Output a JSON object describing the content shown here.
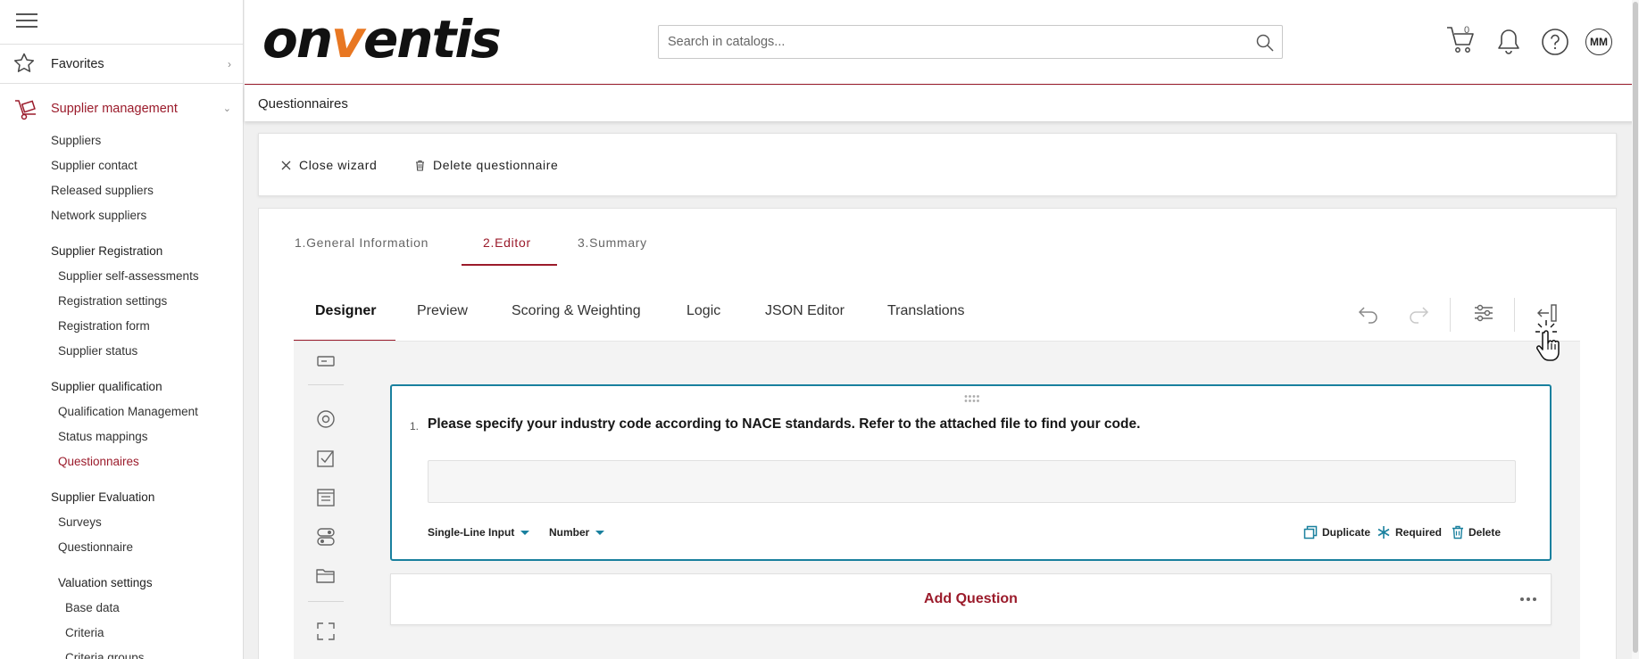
{
  "sidebar": {
    "favorites_label": "Favorites",
    "supplier_management_label": "Supplier management",
    "items": [
      "Suppliers",
      "Supplier contact",
      "Released suppliers",
      "Network suppliers"
    ],
    "registration_heading": "Supplier Registration",
    "registration_items": [
      "Supplier self-assessments",
      "Registration settings",
      "Registration form",
      "Supplier status"
    ],
    "qualification_heading": "Supplier qualification",
    "qualification_items": [
      "Qualification Management",
      "Status mappings",
      "Questionnaires"
    ],
    "evaluation_heading": "Supplier Evaluation",
    "evaluation_items": [
      "Surveys",
      "Questionnaire"
    ],
    "valuation_heading": "Valuation settings",
    "valuation_items": [
      "Base data",
      "Criteria",
      "Criteria groups"
    ]
  },
  "header": {
    "logo_pre": "on",
    "logo_v": "v",
    "logo_post": "entis",
    "search_placeholder": "Search in catalogs...",
    "cart_count": "0",
    "avatar_initials": "MM"
  },
  "page": {
    "title": "Questionnaires"
  },
  "wizard_toolbar": {
    "close_label": "Close wizard",
    "delete_label": "Delete questionnaire"
  },
  "steps": [
    "1.General Information",
    "2.Editor",
    "3.Summary"
  ],
  "tabs": [
    "Designer",
    "Preview",
    "Scoring & Weighting",
    "Logic",
    "JSON Editor",
    "Translations"
  ],
  "question": {
    "number": "1.",
    "text": "Please specify your industry code according to NACE standards. Refer to the attached file to find your code.",
    "type_label": "Single-Line Input",
    "input_type_label": "Number",
    "duplicate_label": "Duplicate",
    "required_label": "Required",
    "delete_label": "Delete"
  },
  "add_question_label": "Add Question",
  "colors": {
    "brand_red": "#9b1b2b",
    "accent_teal": "#19809e",
    "logo_orange": "#e87722"
  }
}
